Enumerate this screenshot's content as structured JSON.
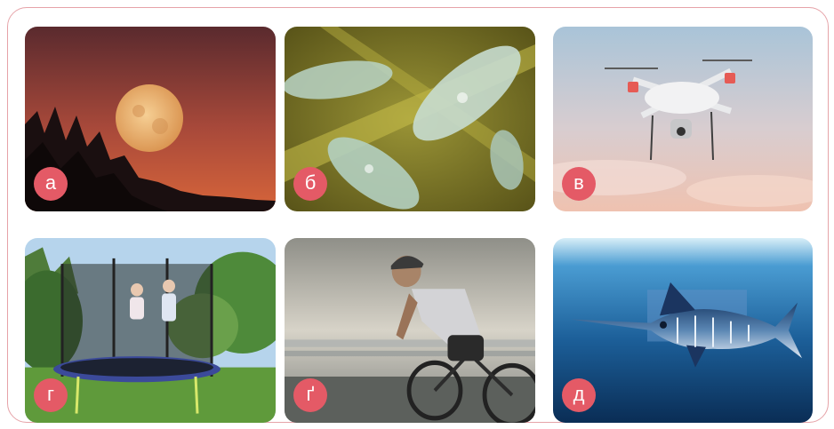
{
  "panels": [
    {
      "label": "а",
      "subject": "moon-over-trees"
    },
    {
      "label": "б",
      "subject": "paramecium-microorganisms"
    },
    {
      "label": "в",
      "subject": "quadcopter-drone"
    },
    {
      "label": "г",
      "subject": "children-on-trampoline"
    },
    {
      "label": "ґ",
      "subject": "cyclist-on-road-bike"
    },
    {
      "label": "д",
      "subject": "swordfish-underwater"
    }
  ],
  "colors": {
    "badge": "#e45a66",
    "frame": "#e6a3a8"
  }
}
